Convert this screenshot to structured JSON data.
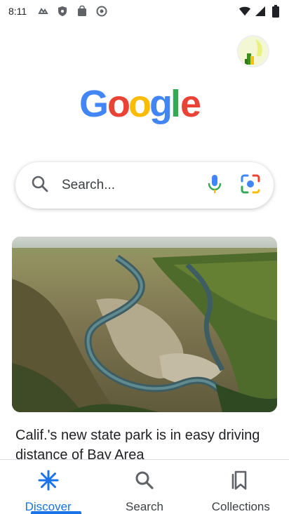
{
  "status_bar": {
    "time": "8:11",
    "icons_left": [
      "data-saver-icon",
      "shield-icon",
      "store-bag-icon",
      "location-target-icon"
    ],
    "icons_right": [
      "wifi-icon",
      "cell-signal-icon",
      "battery-icon"
    ]
  },
  "logo": {
    "text": "Google",
    "colors": [
      "#4285F4",
      "#EA4335",
      "#FBBC05",
      "#4285F4",
      "#34A853",
      "#EA4335"
    ]
  },
  "search": {
    "placeholder": "Search...",
    "search_icon": "search-icon",
    "voice_icon": "microphone-icon",
    "lens_icon": "lens-camera-icon"
  },
  "feed": {
    "card": {
      "image": "river-landscape-photo",
      "title": "Calif.'s new state park is in easy driving distance of Bay Area"
    }
  },
  "bottom_nav": {
    "items": [
      {
        "label": "Discover",
        "icon": "discover-asterisk-icon",
        "active": true
      },
      {
        "label": "Search",
        "icon": "search-icon",
        "active": false
      },
      {
        "label": "Collections",
        "icon": "collections-bookmark-icon",
        "active": false
      }
    ],
    "accent": "#1a73e8"
  }
}
